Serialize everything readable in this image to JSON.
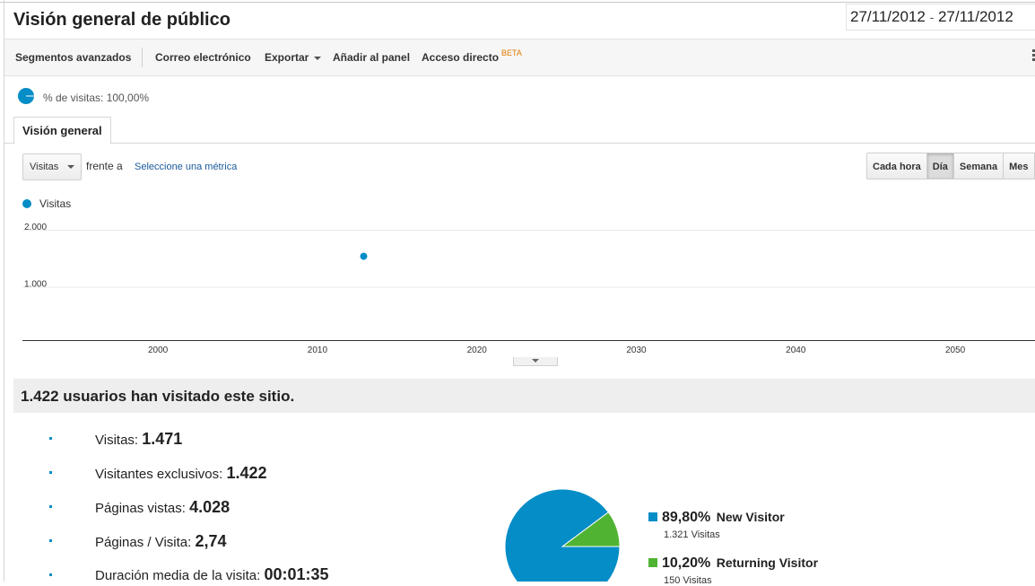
{
  "page": {
    "title": "Visión general de público",
    "date_range": {
      "start": "27/11/2012",
      "separator": "-",
      "end": "27/11/2012"
    }
  },
  "toolbar": {
    "items": [
      {
        "label": "Segmentos avanzados"
      },
      {
        "label": "Correo electrónico"
      },
      {
        "label": "Exportar"
      },
      {
        "label": "Añadir al panel"
      },
      {
        "label": "Acceso directo",
        "badge": "BETA"
      }
    ],
    "icons": [
      "chevron-down-icon",
      "grid-icon"
    ]
  },
  "segment": {
    "label": "% de visitas: 100,00%",
    "icon": "pie-segment-icon"
  },
  "tabs": [
    {
      "label": "Visión general",
      "active": true
    }
  ],
  "metric_selector": {
    "selected": "Visitas",
    "versus": "frente a",
    "link": "Seleccione una métrica"
  },
  "granularity": {
    "buttons": [
      {
        "label": "Cada hora",
        "active": false
      },
      {
        "label": "Día",
        "active": true
      },
      {
        "label": "Semana",
        "active": false
      },
      {
        "label": "Mes",
        "active": false
      }
    ]
  },
  "chart_legend": {
    "label": "Visitas",
    "color": "#058dc7"
  },
  "chart_data": {
    "type": "scatter",
    "title": "",
    "xlabel": "",
    "ylabel": "",
    "series": [
      {
        "name": "Visitas",
        "x": [
          2012.9
        ],
        "y": [
          1471
        ],
        "color": "#058dc7"
      }
    ],
    "x_ticks": [
      "2000",
      "2010",
      "2020",
      "2030",
      "2040",
      "2050"
    ],
    "x_tick_values": [
      2000,
      2010,
      2020,
      2030,
      2040,
      2050
    ],
    "y_ticks": [
      "1.000",
      "2.000"
    ],
    "y_tick_values": [
      1000,
      2000
    ],
    "xlim": [
      1991.5,
      2055
    ],
    "ylim": [
      0,
      2000
    ],
    "grid": true
  },
  "summary": {
    "headline": "1.422 usuarios han visitado este sitio.",
    "stats": [
      {
        "label": "Visitas:",
        "value": "1.471"
      },
      {
        "label": "Visitantes exclusivos:",
        "value": "1.422"
      },
      {
        "label": "Páginas vistas:",
        "value": "4.028"
      },
      {
        "label": "Páginas / Visita:",
        "value": "2,74"
      },
      {
        "label": "Duración media de la visita:",
        "value": "00:01:35"
      }
    ]
  },
  "visitor_pie": {
    "type": "pie",
    "slices": [
      {
        "name": "New Visitor",
        "pct_label": "89,80%",
        "value": 89.8,
        "count_label": "1.321 Visitas",
        "color": "#058dc7"
      },
      {
        "name": "Returning Visitor",
        "pct_label": "10,20%",
        "value": 10.2,
        "count_label": "150 Visitas",
        "color": "#50b432"
      }
    ]
  }
}
